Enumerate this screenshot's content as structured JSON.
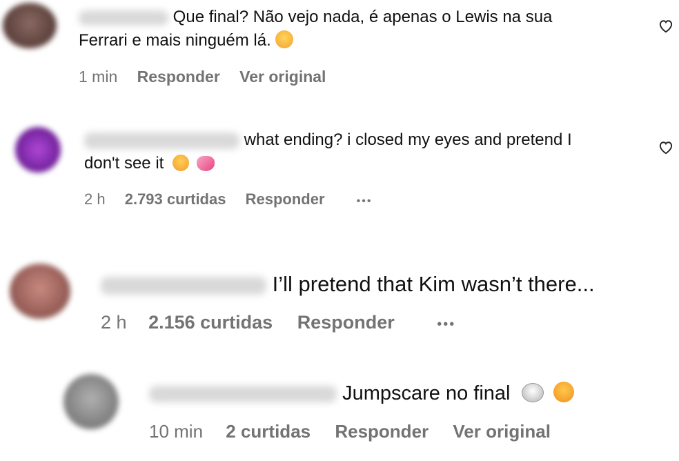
{
  "comments": [
    {
      "text_line1": "Que final? Não vejo nada, é apenas o Lewis na sua",
      "text_line2": "Ferrari e mais ninguém lá.",
      "time": "1 min",
      "reply": "Responder",
      "see_original": "Ver original",
      "emoji": "grimacing-face-emoji",
      "colors": {
        "avatar": "#6b4a44"
      }
    },
    {
      "text_line1": "what ending? i closed my eyes and pretend I",
      "text_line2": "don't see it",
      "time": "2 h",
      "likes": "2.793 curtidas",
      "reply": "Responder",
      "more": "•••",
      "emojis": [
        "relieved-face-emoji",
        "pink-heart-emoji"
      ],
      "colors": {
        "avatar": "#8a2bb8"
      }
    },
    {
      "text": "I’ll pretend that Kim wasn’t there...",
      "time": "2 h",
      "likes": "2.156 curtidas",
      "reply": "Responder",
      "more": "•••",
      "colors": {
        "avatar": "#b0706a"
      }
    },
    {
      "text": "Jumpscare no final",
      "time": "10 min",
      "likes": "2 curtidas",
      "reply": "Responder",
      "see_original": "Ver original",
      "emojis": [
        "skull-crossbones-emoji",
        "crying-face-emoji"
      ],
      "colors": {
        "avatar": "#8c8c8c"
      }
    }
  ],
  "icons": {
    "like": "heart-outline-icon"
  }
}
